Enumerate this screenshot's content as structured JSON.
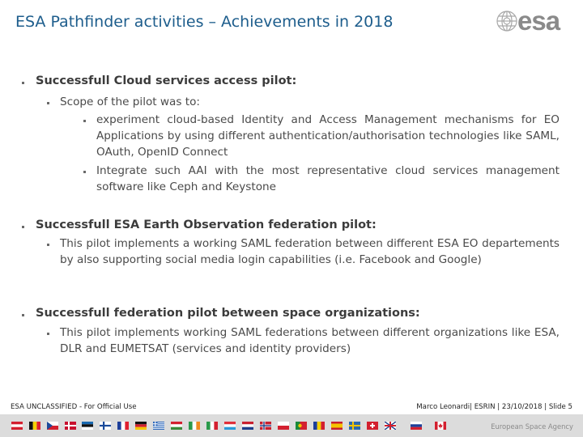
{
  "header": {
    "title": "ESA Pathfinder activities – Achievements in 2018",
    "logo_text": "esa",
    "logo_icon": "esa-globe-icon"
  },
  "sections": [
    {
      "heading": "Successfull Cloud services access pilot:",
      "items": [
        {
          "text": "Scope of the pilot was to:",
          "subitems": [
            "experiment cloud-based Identity and Access Management mechanisms for EO Applications by using different authentication/authorisation technologies like SAML, OAuth, OpenID Connect",
            "Integrate such AAI with the most representative cloud services management software like Ceph and Keystone"
          ]
        }
      ]
    },
    {
      "heading": "Successfull ESA Earth Observation federation pilot:",
      "items": [
        {
          "text": "This pilot implements a working SAML federation between different ESA EO departements by also supporting social media login capabilities (i.e. Facebook and Google)"
        }
      ]
    },
    {
      "heading": "Successfull federation pilot between space organizations:",
      "items": [
        {
          "text": "This pilot implements working SAML federations between different organizations like ESA, DLR and EUMETSAT (services and identity providers)"
        }
      ]
    }
  ],
  "footer": {
    "classification": "ESA UNCLASSIFIED - For Official Use",
    "author_info": "Marco Leonardi| ESRIN | 23/10/2018 | Slide  5",
    "agency": "European Space Agency"
  },
  "flags": [
    "austria",
    "belgium",
    "czech-republic",
    "denmark",
    "estonia",
    "finland",
    "france",
    "germany",
    "greece",
    "hungary",
    "ireland",
    "italy",
    "luxembourg",
    "netherlands",
    "norway",
    "poland",
    "portugal",
    "romania",
    "spain",
    "sweden",
    "switzerland",
    "united-kingdom",
    "slovenia",
    "canada"
  ],
  "colors": {
    "title": "#1d5d8c",
    "heading": "#3c3c3c",
    "body": "#4a4a4a",
    "flag_bar": "#dcdcdc"
  }
}
